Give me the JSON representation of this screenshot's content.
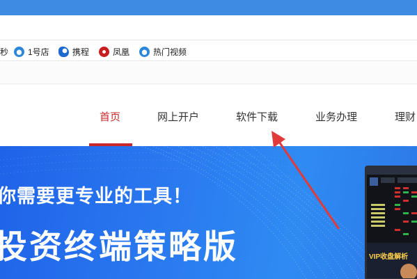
{
  "bookmarks": [
    {
      "label": "秒",
      "icon": "none"
    },
    {
      "label": "1号店",
      "icon": "ie-icon"
    },
    {
      "label": "携程",
      "icon": "ctrip-icon"
    },
    {
      "label": "凤凰",
      "icon": "ifeng-icon"
    },
    {
      "label": "热门视频",
      "icon": "ie-icon"
    }
  ],
  "nav": {
    "items": [
      "首页",
      "网上开户",
      "软件下载",
      "业务办理",
      "理财"
    ],
    "active_index": 0
  },
  "banner": {
    "subtitle": "你需要更专业的工具！",
    "title": "投资终端策略版",
    "vip_label": "VIP收盘解析"
  },
  "colors": {
    "accent_red": "#c7292a",
    "titlebar_blue": "#3d8be3",
    "banner_blue": "#2a79f0"
  }
}
